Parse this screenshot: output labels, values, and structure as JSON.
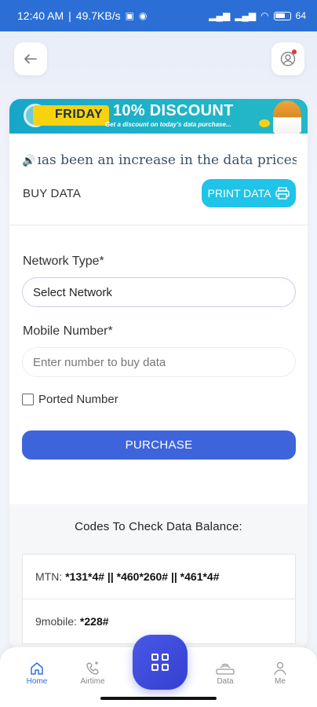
{
  "status_bar": {
    "time": "12:40 AM",
    "speed": "49.7KB/s",
    "battery": "64"
  },
  "banner": {
    "tag": "FRIDAY",
    "headline": "10% DISCOUNT",
    "subline": "Get a discount on today's data purchase..."
  },
  "ticker": {
    "text": "ıas been an increase in the data prices fo"
  },
  "page": {
    "section_title": "BUY DATA",
    "print_button": "PRINT DATA"
  },
  "form": {
    "network_label": "Network Type*",
    "network_value": "Select Network",
    "mobile_label": "Mobile Number*",
    "mobile_placeholder": "Enter number to buy data",
    "ported_label": "Ported Number",
    "ported_checked": false,
    "purchase_button": "PURCHASE"
  },
  "codes": {
    "title": "Codes To Check Data Balance:",
    "rows": [
      {
        "network": "MTN:",
        "code": "*131*4# || *460*260# || *461*4#"
      },
      {
        "network": "9mobile:",
        "code": "*228#"
      }
    ]
  },
  "bottom_nav": {
    "items": [
      {
        "label": "Home",
        "icon": "home-icon",
        "active": true
      },
      {
        "label": "Airtime",
        "icon": "phone-icon",
        "active": false
      },
      {
        "label": "Data",
        "icon": "router-icon",
        "active": false
      },
      {
        "label": "Me",
        "icon": "person-icon",
        "active": false
      }
    ]
  },
  "colors": {
    "status_bar": "#2b6fd6",
    "accent_cyan": "#1fc4e8",
    "primary_blue": "#3e64dc",
    "banner_yellow": "#f6d20f",
    "active_nav": "#2e6ee0"
  }
}
